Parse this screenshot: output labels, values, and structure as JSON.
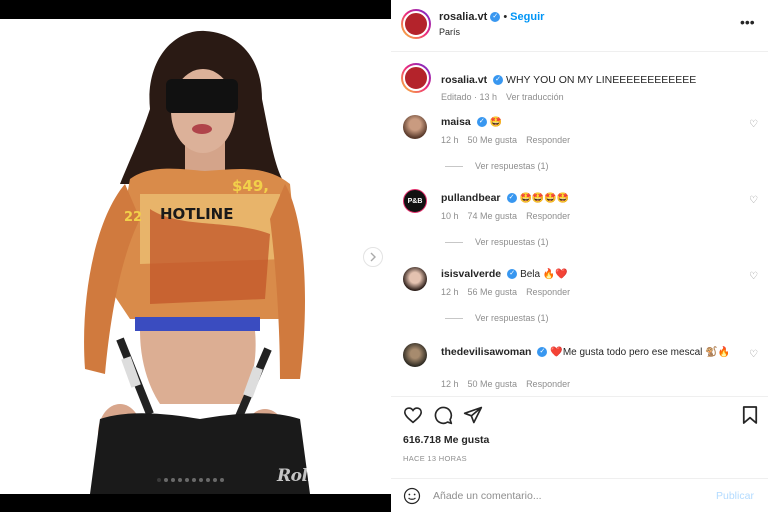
{
  "post": {
    "username": "rosalia.vt",
    "follow_label": "Seguir",
    "location": "París",
    "caption": "WHY YOU ON MY LINEEEEEEEEEEEE",
    "caption_meta_time": "Editado · 13 h",
    "caption_translate": "Ver traducción",
    "likes": "616.718 Me gusta",
    "time_ago": "HACE 13 HORAS",
    "slide_count": 10,
    "active_slide": 1,
    "watermark": "RollingStone",
    "photo_text_top": "$49,",
    "photo_text_hotline": "HOTLINE",
    "photo_text_22": "22"
  },
  "comments": [
    {
      "username": "maisa",
      "text": "🤩",
      "time": "12 h",
      "likes": "50 Me gusta",
      "reply_label": "Responder",
      "view_replies": "Ver respuestas (1)"
    },
    {
      "username": "pullandbear",
      "text": "🤩🤩🤩🤩",
      "time": "10 h",
      "likes": "74 Me gusta",
      "reply_label": "Responder",
      "view_replies": "Ver respuestas (1)",
      "avatar_text": "P&B"
    },
    {
      "username": "isisvalverde",
      "text": "Bela 🔥❤️",
      "time": "12 h",
      "likes": "56 Me gusta",
      "reply_label": "Responder",
      "view_replies": "Ver respuestas (1)"
    },
    {
      "username": "thedevilisawoman",
      "text": "❤️Me gusta todo pero ese mescal 🐒🔥",
      "time": "12 h",
      "likes": "50 Me gusta",
      "reply_label": "Responder"
    }
  ],
  "actions": {
    "like_icon": "heart-icon",
    "comment_icon": "comment-icon",
    "share_icon": "send-icon",
    "save_icon": "bookmark-icon"
  },
  "add_comment": {
    "placeholder": "Añade un comentario...",
    "publish_label": "Publicar"
  },
  "colors": {
    "accent": "#0095f6",
    "publish_disabled": "#b3dbff",
    "muted": "#8e8e8e",
    "text": "#262626"
  }
}
